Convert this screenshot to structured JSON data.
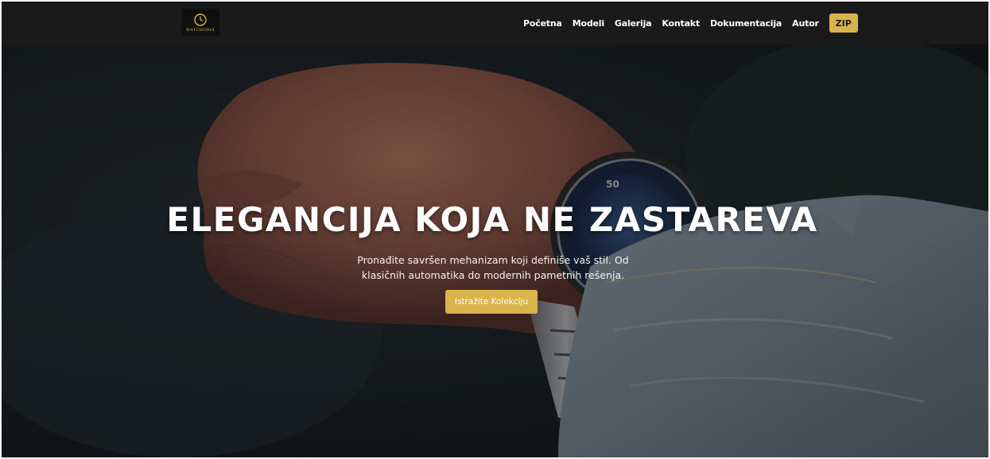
{
  "navbar": {
    "logo": {
      "icon": "watch-logo-icon",
      "text": "WATCHORIA"
    },
    "links": [
      "Početna",
      "Modeli",
      "Galerija",
      "Kontakt",
      "Dokumentacija",
      "Autor"
    ],
    "zip_label": "ZIP"
  },
  "hero": {
    "title": "ELEGANCIJA KOJA NE ZASTAREVA",
    "subtitle": "Pronađite savršen mehanizam koji definiše vaš stil. Od klasičnih automatika do modernih pametnih rešenja.",
    "cta_label": "Istražite Kolekciju",
    "dial_number": "50"
  },
  "colors": {
    "accent": "#d9b44a",
    "navbar_bg": "#1a1a1a",
    "text": "#ffffff"
  }
}
